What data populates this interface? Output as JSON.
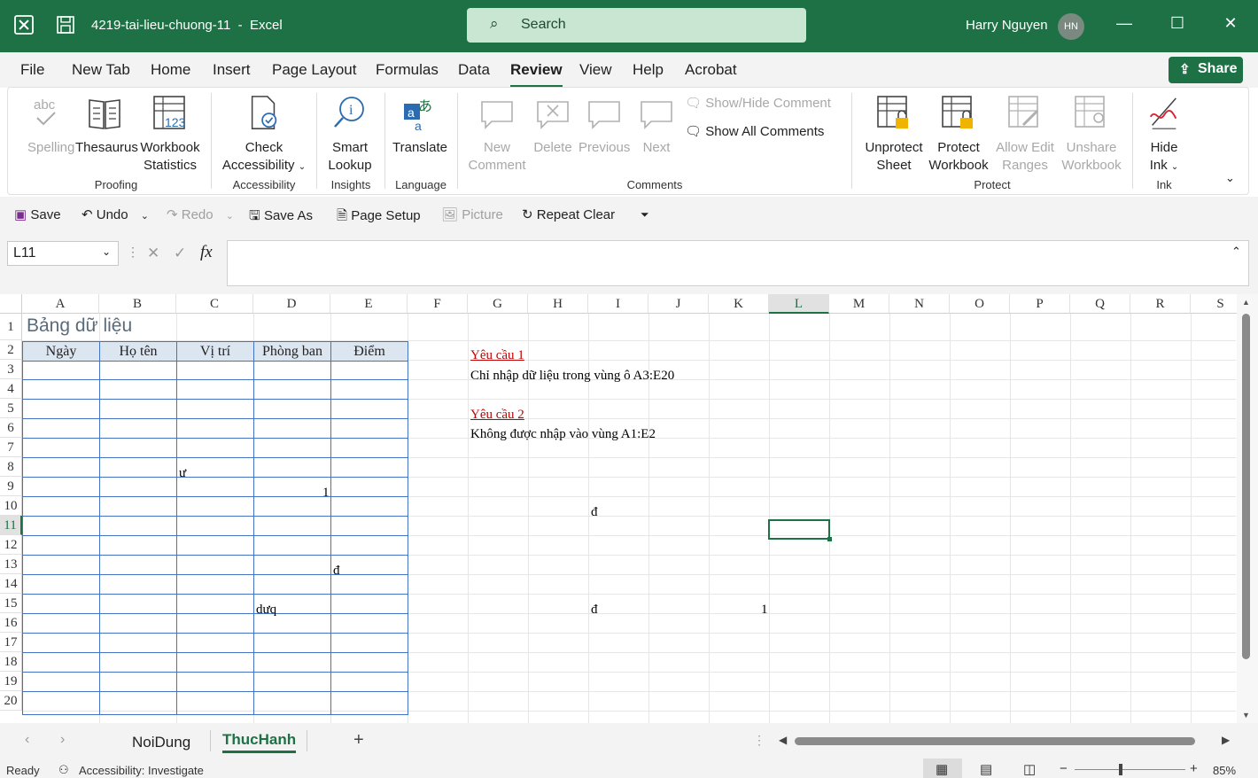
{
  "titlebar": {
    "filename": "4219-tai-lieu-chuong-11",
    "app": "Excel",
    "search_placeholder": "Search",
    "user_name": "Harry Nguyen",
    "user_initials": "HN"
  },
  "menu": {
    "tabs": [
      "File",
      "New Tab",
      "Home",
      "Insert",
      "Page Layout",
      "Formulas",
      "Data",
      "Review",
      "View",
      "Help",
      "Acrobat"
    ],
    "active": "Review",
    "share_label": "Share"
  },
  "ribbon": {
    "spelling": "Spelling",
    "thesaurus": "Thesaurus",
    "workbook_statistics_1": "Workbook",
    "workbook_statistics_2": "Statistics",
    "check_accessibility_1": "Check",
    "check_accessibility_2": "Accessibility",
    "smart_lookup_1": "Smart",
    "smart_lookup_2": "Lookup",
    "translate": "Translate",
    "new_comment_1": "New",
    "new_comment_2": "Comment",
    "delete": "Delete",
    "previous": "Previous",
    "next": "Next",
    "show_hide_comment": "Show/Hide Comment",
    "show_all_comments": "Show All Comments",
    "unprotect_sheet_1": "Unprotect",
    "unprotect_sheet_2": "Sheet",
    "protect_workbook_1": "Protect",
    "protect_workbook_2": "Workbook",
    "allow_edit_ranges_1": "Allow Edit",
    "allow_edit_ranges_2": "Ranges",
    "unshare_workbook_1": "Unshare",
    "unshare_workbook_2": "Workbook",
    "hide_ink_1": "Hide",
    "hide_ink_2": "Ink",
    "groups": {
      "proofing": "Proofing",
      "accessibility": "Accessibility",
      "insights": "Insights",
      "language": "Language",
      "comments": "Comments",
      "protect": "Protect",
      "ink": "Ink"
    }
  },
  "qat": {
    "save": "Save",
    "undo": "Undo",
    "redo": "Redo",
    "save_as": "Save As",
    "page_setup": "Page Setup",
    "picture": "Picture",
    "repeat_clear": "Repeat Clear"
  },
  "formula_bar": {
    "name_box": "L11",
    "fx": "fx",
    "formula": ""
  },
  "sheet": {
    "columns": [
      "A",
      "B",
      "C",
      "D",
      "E",
      "F",
      "G",
      "H",
      "I",
      "J",
      "K",
      "L",
      "M",
      "N",
      "O",
      "P",
      "Q",
      "R",
      "S"
    ],
    "selected_column": "L",
    "rows": [
      "1",
      "2",
      "3",
      "4",
      "5",
      "6",
      "7",
      "8",
      "9",
      "10",
      "11",
      "12",
      "13",
      "14",
      "15",
      "16",
      "17",
      "18",
      "19",
      "20"
    ],
    "selected_row": "11",
    "title": "Bảng dữ liệu",
    "headers": [
      "Ngày",
      "Họ tên",
      "Vị trí",
      "Phòng ban",
      "Điểm"
    ],
    "req1_title": "Yêu cầu 1",
    "req1_text": "Chỉ nhập dữ liệu trong vùng ô A3:E20",
    "req2_title": "Yêu cầu 2",
    "req2_text": "Không được nhập vào vùng A1:E2",
    "c8": "ư",
    "d9": "1",
    "i10": "đ",
    "e13": "đ",
    "d15": "dưq",
    "i15": "đ",
    "k15": "1",
    "accent_red": "#c00000",
    "header_fill": "#dce6f1",
    "border_blue": "#4472c4"
  },
  "sheet_tabs": {
    "tabs": [
      "NoiDung",
      "ThucHanh"
    ],
    "active": "ThucHanh"
  },
  "status": {
    "ready": "Ready",
    "accessibility": "Accessibility: Investigate",
    "zoom": "85%"
  },
  "colors": {
    "excel_green": "#1e7145"
  }
}
